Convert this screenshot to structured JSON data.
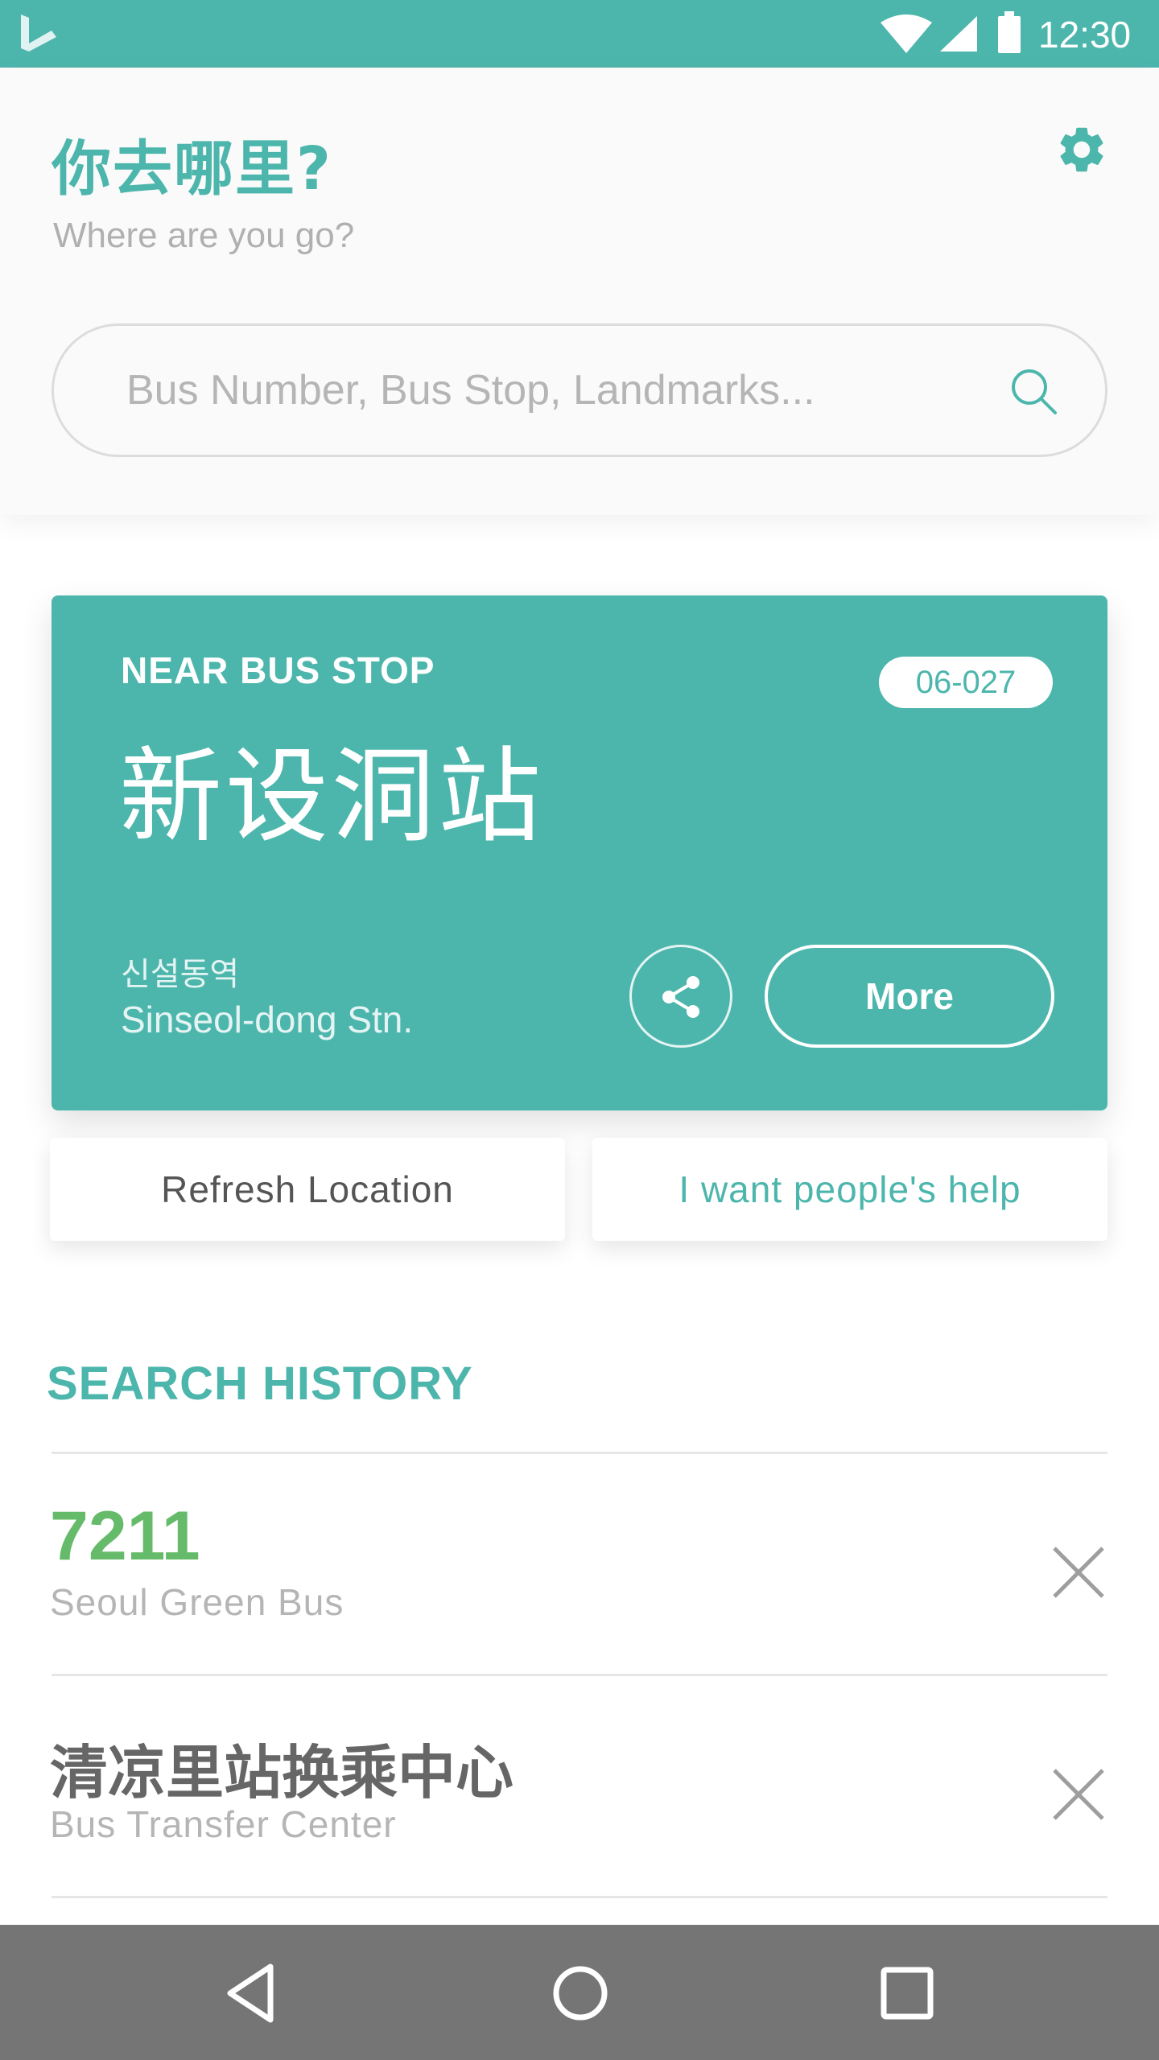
{
  "status_bar": {
    "time": "12:30",
    "icons": [
      "app-logo-icon",
      "wifi-icon",
      "signal-icon",
      "battery-icon"
    ]
  },
  "header": {
    "title": "你去哪里?",
    "subtitle": "Where are you go?",
    "settings_icon": "gear-icon"
  },
  "search": {
    "placeholder": "Bus Number, Bus Stop, Landmarks...",
    "value": ""
  },
  "near_stop": {
    "label": "NEAR BUS STOP",
    "code": "06-027",
    "name": "新设洞站",
    "name_korean": "신설동역",
    "name_roman": "Sinseol-dong Stn.",
    "more_label": "More"
  },
  "actions": {
    "refresh_label": "Refresh Location",
    "help_label": "I want people's help"
  },
  "history": {
    "title": "SEARCH HISTORY",
    "items": [
      {
        "main": "7211",
        "sub": "Seoul Green Bus"
      },
      {
        "main": "清凉里站换乘中心",
        "sub": "Bus Transfer Center"
      }
    ]
  },
  "colors": {
    "accent": "#4db6ac",
    "green_bus": "#66bb6a",
    "navbar": "#757575"
  }
}
